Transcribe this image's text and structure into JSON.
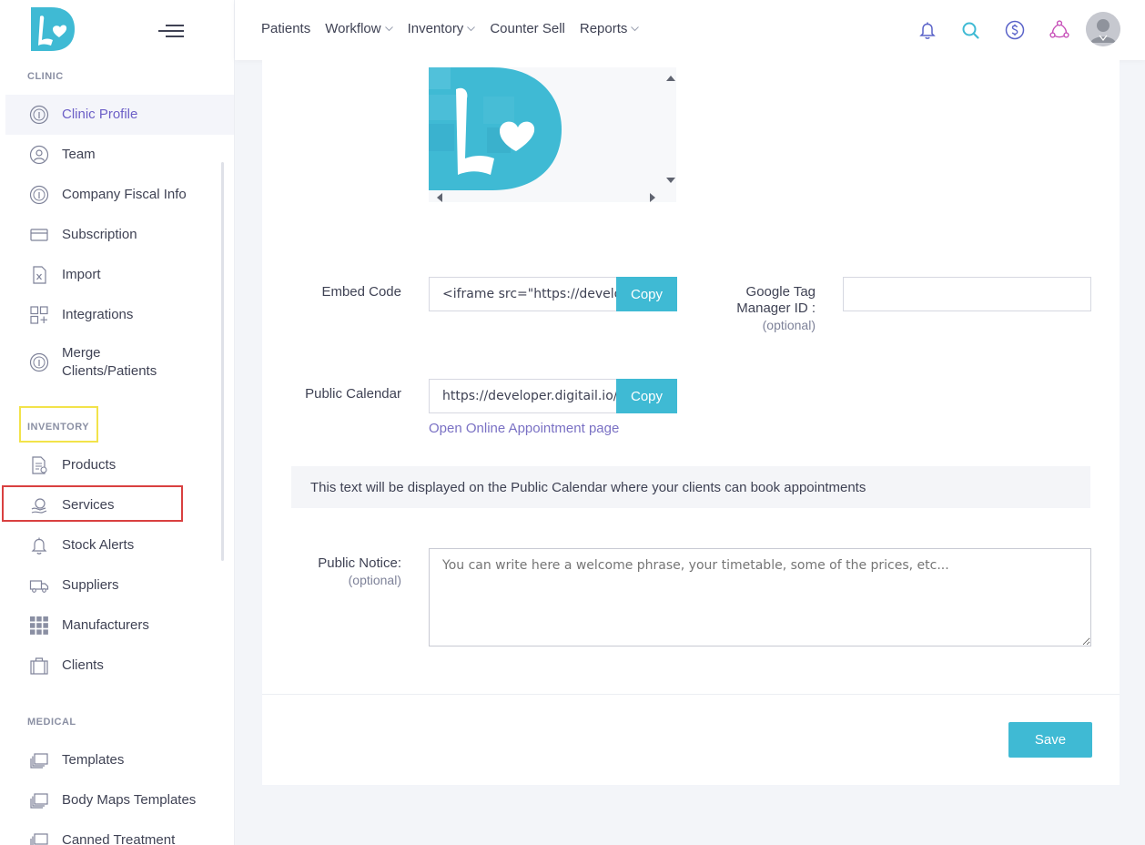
{
  "brand": {
    "accent": "#3fbad4",
    "active_text": "#6c5fc7"
  },
  "sidebar": {
    "sections": {
      "clinic": "CLINIC",
      "inventory": "INVENTORY",
      "medical": "MEDICAL"
    },
    "clinic_items": [
      {
        "label": "Clinic Profile",
        "icon": "info-circle-icon",
        "active": true
      },
      {
        "label": "Team",
        "icon": "user-circle-icon"
      },
      {
        "label": "Company Fiscal Info",
        "icon": "info-circle-icon"
      },
      {
        "label": "Subscription",
        "icon": "credit-card-icon"
      },
      {
        "label": "Import",
        "icon": "file-excel-icon"
      },
      {
        "label": "Integrations",
        "icon": "grid-plus-icon"
      },
      {
        "label": "Merge Clients/Patients",
        "icon": "info-circle-icon"
      }
    ],
    "inventory_items": [
      {
        "label": "Products",
        "icon": "document-icon"
      },
      {
        "label": "Services",
        "icon": "services-icon"
      },
      {
        "label": "Stock Alerts",
        "icon": "bell-icon"
      },
      {
        "label": "Suppliers",
        "icon": "truck-icon"
      },
      {
        "label": "Manufacturers",
        "icon": "grid-icon"
      },
      {
        "label": "Clients",
        "icon": "briefcase-icon"
      }
    ],
    "medical_items": [
      {
        "label": "Templates",
        "icon": "stack-icon"
      },
      {
        "label": "Body Maps Templates",
        "icon": "stack-icon"
      },
      {
        "label": "Canned Treatment",
        "icon": "stack-icon"
      }
    ]
  },
  "topnav": [
    {
      "label": "Patients",
      "dropdown": false
    },
    {
      "label": "Workflow",
      "dropdown": true
    },
    {
      "label": "Inventory",
      "dropdown": true
    },
    {
      "label": "Counter Sell",
      "dropdown": false
    },
    {
      "label": "Reports",
      "dropdown": true
    }
  ],
  "form": {
    "embed_code": {
      "label": "Embed Code",
      "value": "<iframe src=\"https://develope",
      "copy": "Copy"
    },
    "gtm": {
      "label_line1": "Google Tag",
      "label_line2": "Manager ID :",
      "optional": "(optional)",
      "value": ""
    },
    "public_calendar": {
      "label": "Public Calendar",
      "value": "https://developer.digitail.io/cli",
      "copy": "Copy"
    },
    "open_link": "Open Online Appointment page",
    "info_text": "This text will be displayed on the Public Calendar where your clients can book appointments",
    "public_notice": {
      "label": "Public Notice:",
      "optional": "(optional)",
      "placeholder": "You can write here a welcome phrase, your timetable, some of the prices, etc..."
    },
    "save": "Save"
  }
}
